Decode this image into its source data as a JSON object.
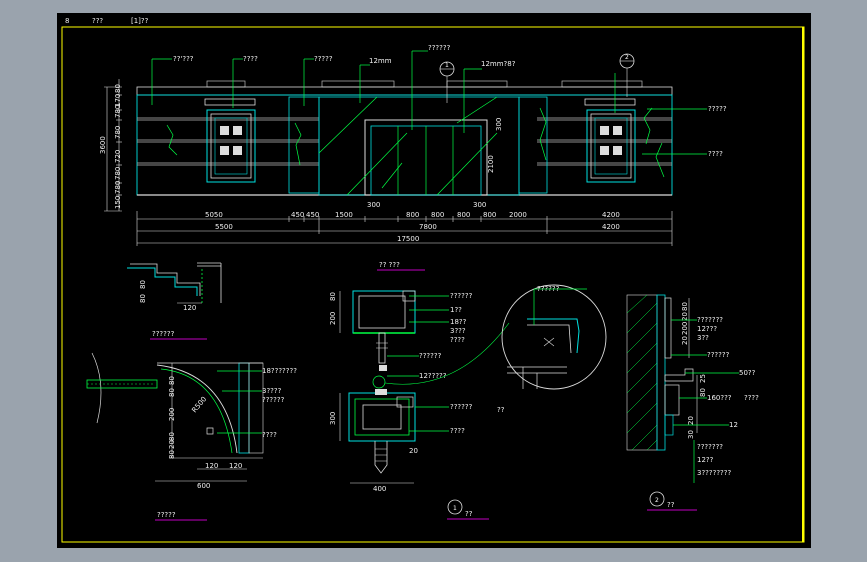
{
  "header": {
    "num": "8",
    "title": "???",
    "sub": "[1]??"
  },
  "colors": {
    "background": "#000000",
    "frame": "#ffff00",
    "leader": "#00ff44",
    "wall": "#00e0e0",
    "dim": "#ffffff",
    "underline": "#ff00ff"
  },
  "elevation": {
    "callouts": [
      "??'???",
      "????",
      "?????",
      "12mm",
      "??????",
      "12mm?8?",
      "?????",
      "????"
    ],
    "sec_marks": [
      "1",
      "2"
    ],
    "dims_bottom_row1": [
      "5050",
      "450",
      "450",
      "1500",
      "800",
      "800",
      "800",
      "800",
      "2000",
      "4200"
    ],
    "dims_bottom_row2": [
      "5500",
      "7800",
      "4200"
    ],
    "dims_total": "17500",
    "dims_300": [
      "300",
      "300"
    ],
    "dims_left": [
      "150",
      "780",
      "780",
      "720",
      "780",
      "780",
      "170",
      "80"
    ],
    "dims_left_total": "3600",
    "dim_door_h": "2100",
    "dim_transom": "300"
  },
  "center_detail": {
    "title": "?? ???",
    "labels_top": [
      "??????",
      "1??",
      "18??",
      "3???",
      "????"
    ],
    "labels_mid": [
      "??????",
      "12?????"
    ],
    "labels_bot": [
      "??????",
      "????"
    ],
    "callout_q": "??",
    "dims": [
      "80",
      "200",
      "300",
      "20",
      "400"
    ],
    "circle_mark": "1",
    "caption": "??"
  },
  "left_top": {
    "dims": [
      "80",
      "80",
      "120"
    ]
  },
  "left_bottom": {
    "title": "??????",
    "labels": [
      "18???????",
      "3????",
      "??????",
      "????"
    ],
    "dims": [
      "80",
      "80",
      "200",
      "80",
      "20",
      "80",
      "R500",
      "120",
      "120",
      "600"
    ],
    "caption": "?????"
  },
  "right_detail": {
    "labels": [
      "???????",
      "12???",
      "3??",
      "??????",
      "50??",
      "160???",
      "????",
      "12",
      "???????",
      "12??",
      "3????????"
    ],
    "dims": [
      "80",
      "20",
      "200",
      "20",
      "25",
      "80",
      "20",
      "30"
    ],
    "circle_mark": "2",
    "caption": "??"
  }
}
